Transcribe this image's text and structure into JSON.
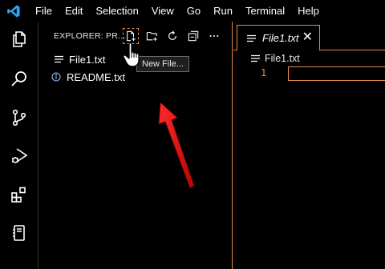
{
  "menu": [
    "File",
    "Edit",
    "Selection",
    "View",
    "Go",
    "Run",
    "Terminal",
    "Help"
  ],
  "activity_bar": [
    "explorer-icon",
    "search-icon",
    "source-control-icon",
    "run-debug-icon",
    "extensions-icon",
    "notebook-icon"
  ],
  "explorer": {
    "title": "EXPLORER: PR...",
    "toolbar": [
      "new-file-icon",
      "new-folder-icon",
      "refresh-icon",
      "collapse-all-icon",
      "more-icon"
    ],
    "files": [
      {
        "name": "File1.txt",
        "icon": "file-lines-icon"
      },
      {
        "name": "README.txt",
        "icon": "info-icon"
      }
    ]
  },
  "tooltip": "New File...",
  "editor": {
    "tab_label": "File1.txt",
    "close_label": "✕",
    "breadcrumb": "File1.txt",
    "line_number": "1"
  },
  "colors": {
    "accent": "#e38a4a",
    "vscode_blue": "#2aa3ef",
    "arrow_red": "#e01010"
  }
}
